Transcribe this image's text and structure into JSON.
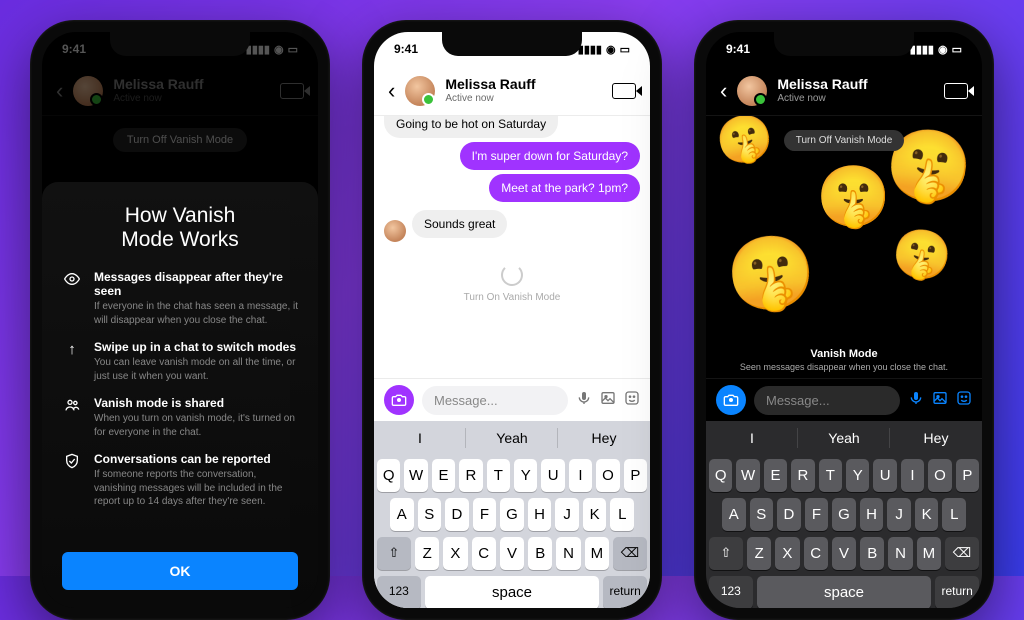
{
  "status": {
    "time": "9:41"
  },
  "contact": {
    "name": "Melissa Rauff",
    "status": "Active now"
  },
  "phone1": {
    "pill": "Turn Off Vanish Mode",
    "sheet_title_l1": "How Vanish",
    "sheet_title_l2": "Mode Works",
    "items": [
      {
        "title": "Messages disappear after they're seen",
        "desc": "If everyone in the chat has seen a message, it will disappear when you close the chat."
      },
      {
        "title": "Swipe up in a chat to switch modes",
        "desc": "You can leave vanish mode on all the time, or just use it when you want."
      },
      {
        "title": "Vanish mode is shared",
        "desc": "When you turn on vanish mode, it's turned on for everyone in the chat."
      },
      {
        "title": "Conversations can be reported",
        "desc": "If someone reports the conversation, vanishing messages will be included in the report up to 14 days after they're seen."
      }
    ],
    "ok": "OK"
  },
  "phone2": {
    "truncated": "Going to be hot on Saturday",
    "out1": "I'm super down for Saturday?",
    "out2": "Meet at the park? 1pm?",
    "in1": "Sounds great",
    "hint": "Turn On Vanish Mode",
    "placeholder": "Message...",
    "suggestions": [
      "I",
      "Yeah",
      "Hey"
    ],
    "row1": [
      "Q",
      "W",
      "E",
      "R",
      "T",
      "Y",
      "U",
      "I",
      "O",
      "P"
    ],
    "row2": [
      "A",
      "S",
      "D",
      "F",
      "G",
      "H",
      "J",
      "K",
      "L"
    ],
    "row3": [
      "Z",
      "X",
      "C",
      "V",
      "B",
      "N",
      "M"
    ],
    "shift": "⇧",
    "del": "⌫",
    "num": "123",
    "space": "space",
    "ret": "return"
  },
  "phone3": {
    "pill": "Turn Off Vanish Mode",
    "info_title": "Vanish Mode",
    "info_desc": "Seen messages disappear when you close the chat.",
    "placeholder": "Message...",
    "suggestions": [
      "I",
      "Yeah",
      "Hey"
    ]
  }
}
